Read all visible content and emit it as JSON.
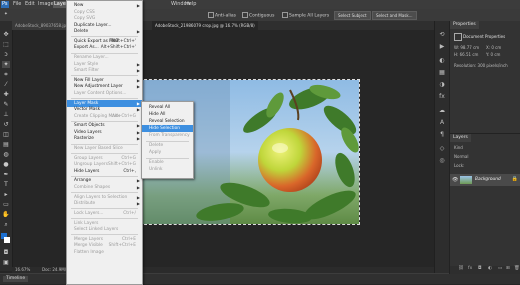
{
  "menubar": {
    "ps_logo": "Ps",
    "items": [
      "File",
      "Edit",
      "Image",
      "Layer",
      "Type",
      "Select",
      "Filter",
      "3D",
      "View",
      "Window",
      "Help"
    ]
  },
  "options": {
    "antialias": "Anti-alias",
    "contiguous": "Contiguous",
    "sample_all": "Sample All Layers",
    "select_subject": "Select Subject",
    "select_mask": "Select and Mask..."
  },
  "tabs": {
    "first": "AdobeStock_89037658.jpg",
    "second": "AdobeStock_21986079 crop.jpg @ 16.7% (RGB/8)"
  },
  "status": {
    "zoom": "16.67%",
    "doc": "Doc: 24.9M/24.9M",
    "timeline": "Timeline"
  },
  "properties": {
    "title": "Properties",
    "header": "Document Properties",
    "w": "W: 98.77 cm",
    "h": "H: 66.51 cm",
    "x": "X: 0 cm",
    "y": "Y: 0 cm",
    "resolution": "Resolution: 300 pixels/inch"
  },
  "layers": {
    "title": "Layers",
    "kind": "Kind",
    "blend": "Normal",
    "lock": "Lock:",
    "layer_name": "Background"
  },
  "layer_menu": {
    "items": [
      {
        "label": "New",
        "arrow": true
      },
      {
        "label": "Copy CSS",
        "disabled": true
      },
      {
        "label": "Copy SVG",
        "disabled": true
      },
      {
        "label": "Duplicate Layer..."
      },
      {
        "label": "Delete",
        "arrow": true
      },
      {
        "sep": true
      },
      {
        "label": "Quick Export as PNG",
        "shortcut": "Shift+Ctrl+'"
      },
      {
        "label": "Export As...",
        "shortcut": "Alt+Shift+Ctrl+'"
      },
      {
        "sep": true
      },
      {
        "label": "Rename Layer...",
        "disabled": true
      },
      {
        "label": "Layer Style",
        "arrow": true,
        "disabled": true
      },
      {
        "label": "Smart Filter",
        "arrow": true,
        "disabled": true
      },
      {
        "sep": true
      },
      {
        "label": "New Fill Layer",
        "arrow": true
      },
      {
        "label": "New Adjustment Layer",
        "arrow": true
      },
      {
        "label": "Layer Content Options...",
        "disabled": true
      },
      {
        "sep": true
      },
      {
        "label": "Layer Mask",
        "arrow": true,
        "highlighted": true
      },
      {
        "label": "Vector Mask",
        "arrow": true
      },
      {
        "label": "Create Clipping Mask",
        "shortcut": "Alt+Ctrl+G",
        "disabled": true
      },
      {
        "sep": true
      },
      {
        "label": "Smart Objects",
        "arrow": true
      },
      {
        "label": "Video Layers",
        "arrow": true
      },
      {
        "label": "Rasterize",
        "arrow": true
      },
      {
        "sep": true
      },
      {
        "label": "New Layer Based Slice",
        "disabled": true
      },
      {
        "sep": true
      },
      {
        "label": "Group Layers",
        "shortcut": "Ctrl+G",
        "disabled": true
      },
      {
        "label": "Ungroup Layers",
        "shortcut": "Shift+Ctrl+G",
        "disabled": true
      },
      {
        "label": "Hide Layers",
        "shortcut": "Ctrl+,"
      },
      {
        "sep": true
      },
      {
        "label": "Arrange",
        "arrow": true
      },
      {
        "label": "Combine Shapes",
        "arrow": true,
        "disabled": true
      },
      {
        "sep": true
      },
      {
        "label": "Align Layers to Selection",
        "arrow": true,
        "disabled": true
      },
      {
        "label": "Distribute",
        "arrow": true,
        "disabled": true
      },
      {
        "sep": true
      },
      {
        "label": "Lock Layers...",
        "shortcut": "Ctrl+/",
        "disabled": true
      },
      {
        "sep": true
      },
      {
        "label": "Link Layers",
        "disabled": true
      },
      {
        "label": "Select Linked Layers",
        "disabled": true
      },
      {
        "sep": true
      },
      {
        "label": "Merge Layers",
        "shortcut": "Ctrl+E",
        "disabled": true
      },
      {
        "label": "Merge Visible",
        "shortcut": "Shift+Ctrl+E",
        "disabled": true
      },
      {
        "label": "Flatten Image",
        "disabled": true
      }
    ]
  },
  "mask_submenu": {
    "items": [
      {
        "label": "Reveal All"
      },
      {
        "label": "Hide All"
      },
      {
        "label": "Reveal Selection"
      },
      {
        "label": "Hide Selection",
        "highlighted": true
      },
      {
        "label": "From Transparency",
        "disabled": true
      },
      {
        "sep": true
      },
      {
        "label": "Delete",
        "disabled": true
      },
      {
        "label": "Apply",
        "disabled": true
      },
      {
        "sep": true
      },
      {
        "label": "Enable",
        "disabled": true
      },
      {
        "label": "Unlink",
        "disabled": true
      }
    ]
  },
  "colors": {
    "highlight": "#3d8fe0",
    "apple": "#c9d93a",
    "leaf": "#3f7a2a"
  }
}
